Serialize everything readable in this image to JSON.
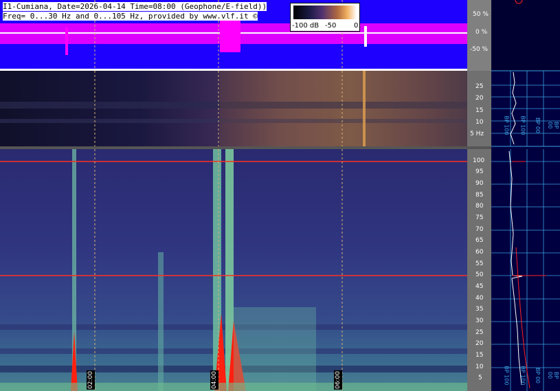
{
  "header": {
    "line1": "I1-Cumiana, Date=2026-04-14 Time=08:00 (Geophone/E-field))",
    "line2": "Freq= 0...30 Hz and 0...105 Hz, provided by www.vlf.it ©"
  },
  "legend": {
    "labels": [
      "-100 dB",
      "-50",
      "0"
    ]
  },
  "waveform_axis": {
    "ticks": [
      "50 %",
      "0 %",
      "-50 %"
    ]
  },
  "low_freq_axis": {
    "ticks": [
      "25",
      "20",
      "15",
      "10",
      "5 Hz"
    ]
  },
  "main_axis": {
    "ticks": [
      "100",
      "95",
      "90",
      "85",
      "80",
      "75",
      "70",
      "65",
      "60",
      "55",
      "50",
      "45",
      "40",
      "35",
      "30",
      "25",
      "20",
      "15",
      "10",
      "5"
    ]
  },
  "time_labels": [
    "02:00",
    "04:00",
    "06:00"
  ],
  "colors": {
    "waveform_bg": "#1e00ff",
    "waveform_trace": "#ff00ff",
    "sidebar_bg": "#000040",
    "grid": "#3ca0e0",
    "line_50hz": "#ff3020"
  },
  "sidebar": {
    "top_labels": [
      "BP 100",
      "BP 100",
      "BP 00",
      "BP 00"
    ],
    "bottom_labels": [
      "BP 100",
      "BP 100",
      "BP 00",
      "BP 00"
    ]
  }
}
